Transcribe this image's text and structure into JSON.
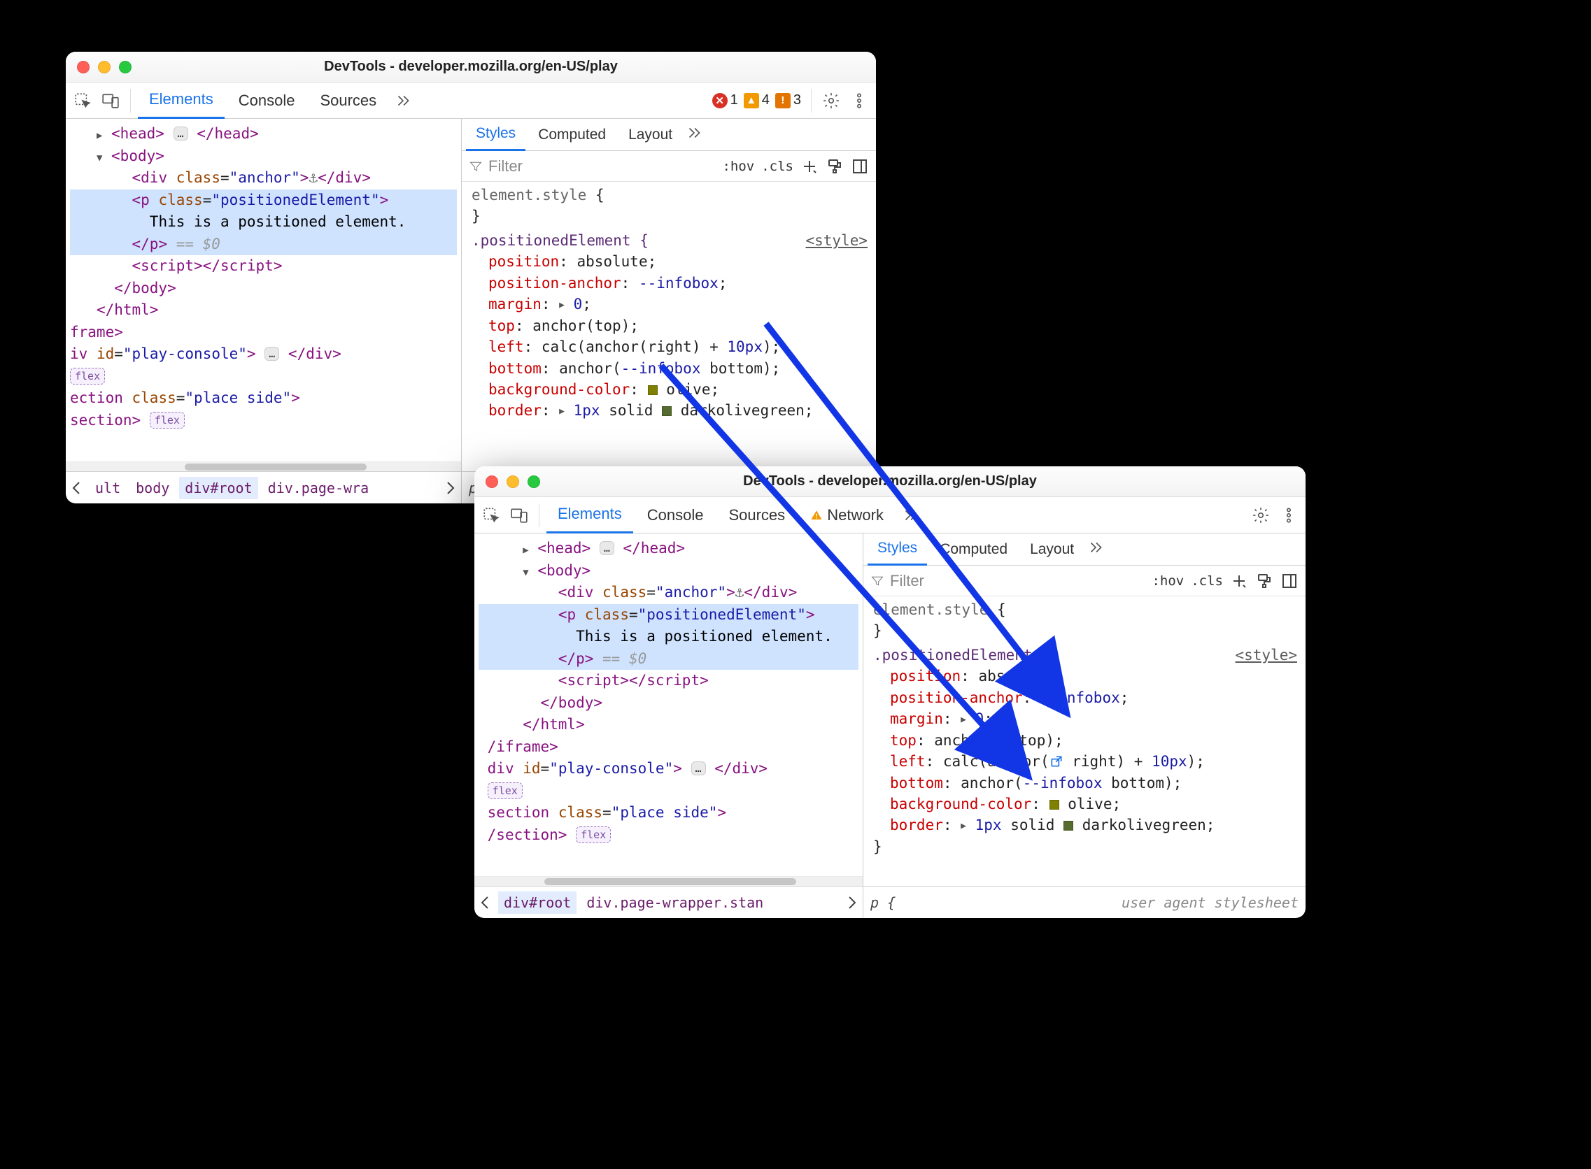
{
  "title": "DevTools - developer.mozilla.org/en-US/play",
  "tabs": {
    "elements": "Elements",
    "console": "Console",
    "sources": "Sources",
    "network": "Network"
  },
  "badges": {
    "errors": "1",
    "warnings": "4",
    "info": "3"
  },
  "styles_tabs": {
    "styles": "Styles",
    "computed": "Computed",
    "layout": "Layout"
  },
  "filter": {
    "placeholder": "Filter",
    "hov": ":hov",
    "cls": ".cls"
  },
  "element_style": {
    "selector": "element.style",
    "body": "{",
    "close": "}"
  },
  "rule_link": "<style>",
  "rule": {
    "selector": ".positionedElement {",
    "close": "}",
    "p_position": "position",
    "v_position": "absolute",
    "p_posanchor": "position-anchor",
    "v_posanchor": "--infobox",
    "p_margin": "margin",
    "v_margin": "0",
    "p_top": "top",
    "v_top_a_pre": "anchor(",
    "v_top_a_arg": "top",
    "v_top_a_post": ")",
    "p_left": "left",
    "v_left_pre": "calc(anchor(",
    "v_left_arg": "right",
    "v_left_mid": ") + ",
    "v_left_px": "10px",
    "v_left_post": ")",
    "p_bottom": "bottom",
    "v_bottom_pre": "anchor(",
    "v_bottom_arg1": "--infobox",
    "v_bottom_arg2": "bottom",
    "v_bottom_post": ")",
    "p_bg": "background-color",
    "v_bg": "olive",
    "p_border": "border",
    "v_border_width": "1px",
    "v_border_style": "solid",
    "v_border_color": "darkolivegreen"
  },
  "ua_footer": {
    "p": "p {",
    "label": "user agent stylesheet"
  },
  "dom": {
    "head_open": "<head>",
    "head_ellipsis": "…",
    "head_close": "</head>",
    "body_open": "<body>",
    "div_anchor_open": "<div",
    "class_attr": "class",
    "anchor_class": "anchor",
    "anchor_char": "⚓",
    "div_close": "</div>",
    "p_open": "<p",
    "pe_class": "positionedElement",
    "p_close_tag": ">",
    "p_text": "This is a positioned element.",
    "p_end": "</p>",
    "eq0": " == $0",
    "script_open": "<script>",
    "script_close": "</script>",
    "body_close": "</body>",
    "html_close": "</html>",
    "iframe_end_a": "frame>",
    "iframe_end_b": "/iframe>",
    "div_play_a": "iv ",
    "div_play_b": "div ",
    "id_attr": "id",
    "play_id": "play-console",
    "div_end": "</div>",
    "flex": "flex",
    "section_a": "ection ",
    "section_b": "section ",
    "place_side": "place side",
    "section_end": "/section>",
    "gt": ">"
  },
  "breadcrumb_a": {
    "items": [
      "ult",
      "body",
      "div#root",
      "div.page-wra"
    ],
    "active_idx": 2
  },
  "breadcrumb_b": {
    "items": [
      "div#root",
      "div.page-wrapper.stan"
    ],
    "active_idx": 0
  }
}
